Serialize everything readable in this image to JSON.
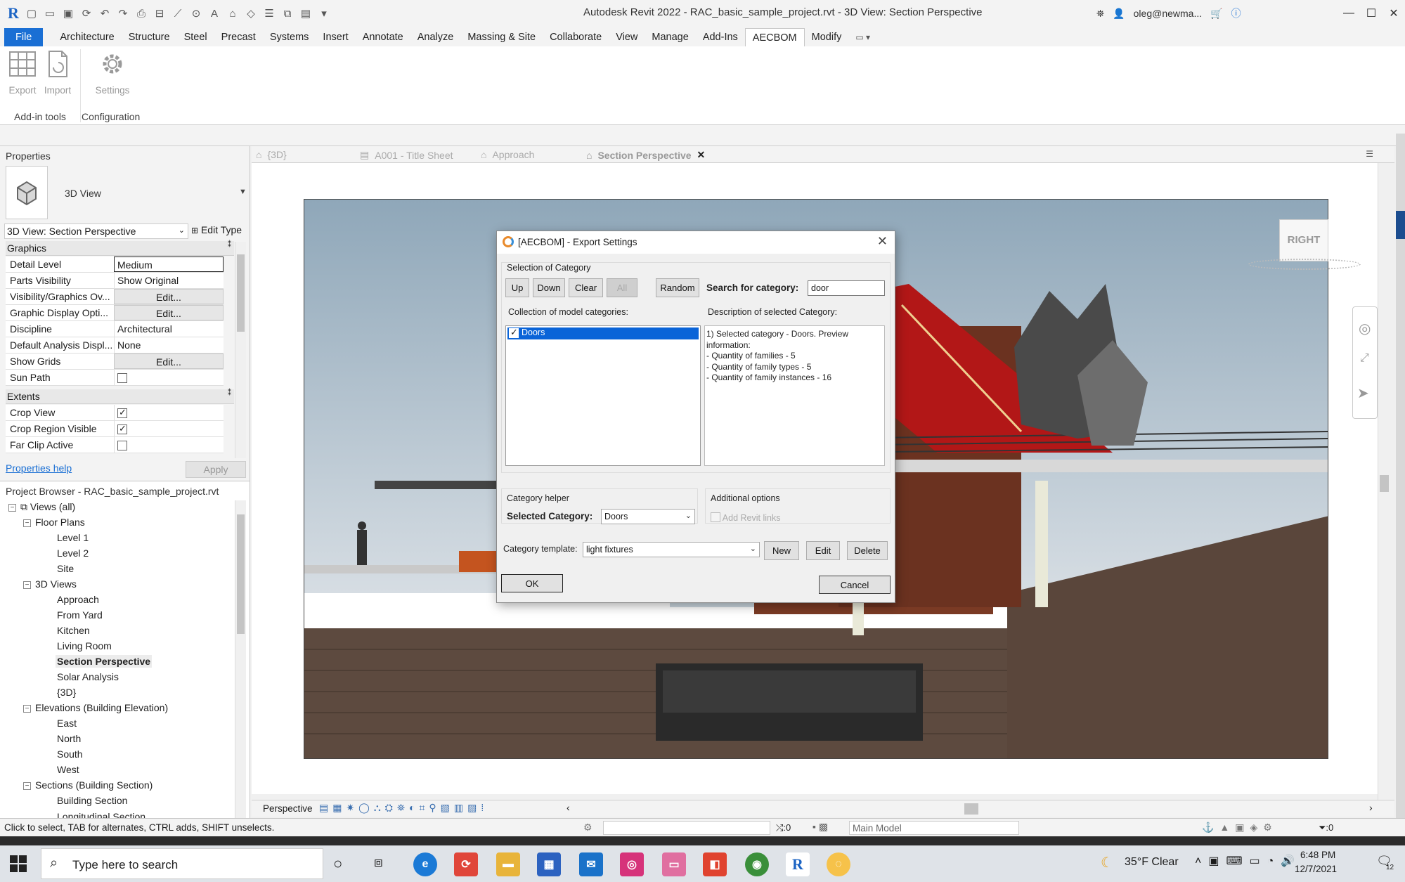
{
  "titlebar": {
    "title": "Autodesk Revit 2022 - RAC_basic_sample_project.rvt - 3D View: Section Perspective",
    "user": "oleg@newma...",
    "app_logo": "R"
  },
  "menu": {
    "file": "File",
    "tabs": [
      "Architecture",
      "Structure",
      "Steel",
      "Precast",
      "Systems",
      "Insert",
      "Annotate",
      "Analyze",
      "Massing & Site",
      "Collaborate",
      "View",
      "Manage",
      "Add-Ins",
      "AECBOM",
      "Modify"
    ],
    "active": "AECBOM"
  },
  "ribbon": {
    "export": "Export",
    "import": "Import",
    "settings": "Settings",
    "panel_addin": "Add-in tools",
    "panel_config": "Configuration"
  },
  "properties": {
    "header": "Properties",
    "type_name": "3D View",
    "instance": "3D View: Section Perspective",
    "edit_type": "Edit Type",
    "group_graphics": "Graphics",
    "rows_graphics": [
      {
        "k": "Detail Level",
        "v": "Medium"
      },
      {
        "k": "Parts Visibility",
        "v": "Show Original"
      },
      {
        "k": "Visibility/Graphics Ov...",
        "v": "Edit..."
      },
      {
        "k": "Graphic Display Opti...",
        "v": "Edit..."
      },
      {
        "k": "Discipline",
        "v": "Architectural"
      },
      {
        "k": "Default Analysis Displ...",
        "v": "None"
      },
      {
        "k": "Show Grids",
        "v": "Edit..."
      },
      {
        "k": "Sun Path",
        "v": ""
      }
    ],
    "group_extents": "Extents",
    "rows_extents": [
      {
        "k": "Crop View",
        "checked": true
      },
      {
        "k": "Crop Region Visible",
        "checked": true
      },
      {
        "k": "Far Clip Active",
        "checked": false
      }
    ],
    "help": "Properties help",
    "apply": "Apply"
  },
  "browser": {
    "header": "Project Browser - RAC_basic_sample_project.rvt",
    "views_all": "Views (all)",
    "floor_plans": "Floor Plans",
    "floor_items": [
      "Level 1",
      "Level 2",
      "Site"
    ],
    "views3d": "3D Views",
    "views3d_items": [
      "Approach",
      "From Yard",
      "Kitchen",
      "Living Room",
      "Section Perspective",
      "Solar Analysis",
      "{3D}"
    ],
    "elevations": "Elevations (Building Elevation)",
    "elev_items": [
      "East",
      "North",
      "South",
      "West"
    ],
    "sections": "Sections (Building Section)",
    "section_items": [
      "Building Section",
      "Longitudinal Section"
    ]
  },
  "viewtabs": [
    "{3D}",
    "A001 - Title Sheet",
    "Approach",
    "Section Perspective"
  ],
  "viewcube": "RIGHT",
  "dialog": {
    "title": "[AECBOM] - Export Settings",
    "selection_group": "Selection of Category",
    "buttons": [
      "Up",
      "Down",
      "Clear",
      "All",
      "Random"
    ],
    "search_label": "Search for category:",
    "search_value": "door",
    "collection_label": "Collection of model categories:",
    "description_label": "Description of selected Category:",
    "list_item": "Doors",
    "description_lines": [
      "1) Selected category - Doors. Preview",
      "information:",
      "- Quantity of families - 5",
      "- Quantity of family types - 5",
      "- Quantity of family instances - 16"
    ],
    "helper_group": "Category helper",
    "selected_category_label": "Selected Category:",
    "selected_category_value": "Doors",
    "additional_group": "Additional options",
    "add_revit_links": "Add Revit links",
    "template_label": "Category template:",
    "template_value": "light fixtures",
    "new": "New",
    "edit": "Edit",
    "delete": "Delete",
    "ok": "OK",
    "cancel": "Cancel"
  },
  "viewbar": {
    "mode": "Perspective"
  },
  "status": {
    "hint": "Click to select, TAB for alternates, CTRL adds, SHIFT unselects.",
    "zero1": ":0",
    "model": "Main Model",
    "zero2": ":0"
  },
  "taskbar": {
    "search_placeholder": "Type here to search",
    "weather": "35°F  Clear",
    "time": "6:48 PM",
    "date": "12/7/2021",
    "notif_count": "12"
  }
}
